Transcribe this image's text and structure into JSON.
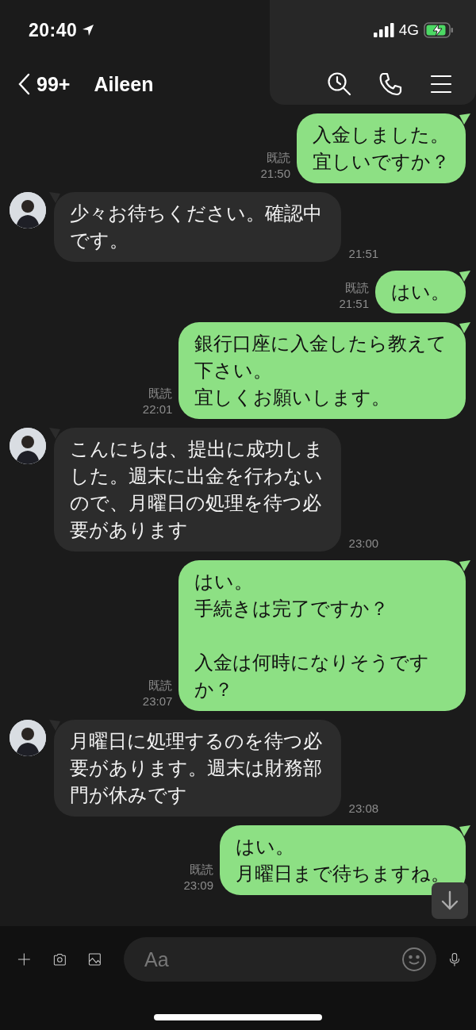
{
  "status_bar": {
    "time": "20:40",
    "network": "4G"
  },
  "header": {
    "back_count": "99+",
    "contact": "Aileen"
  },
  "messages": [
    {
      "kind": "sent",
      "paragraphs": [
        [
          "入金しました。",
          "宜しいですか？"
        ]
      ],
      "read": "既読",
      "time": "21:50"
    },
    {
      "kind": "received",
      "paragraphs": [
        [
          "少々お待ちください。確認中です。"
        ]
      ],
      "time": "21:51"
    },
    {
      "kind": "sent",
      "paragraphs": [
        [
          "はい。"
        ]
      ],
      "read": "既読",
      "time": "21:51"
    },
    {
      "kind": "sent",
      "paragraphs": [
        [
          "銀行口座に入金したら教えて下さい。",
          "宜しくお願いします。"
        ]
      ],
      "read": "既読",
      "time": "22:01"
    },
    {
      "kind": "received",
      "paragraphs": [
        [
          "こんにちは、提出に成功しました。週末に出金を行わないので、月曜日の処理を待つ必要があります"
        ]
      ],
      "time": "23:00"
    },
    {
      "kind": "sent",
      "paragraphs": [
        [
          "はい。",
          "手続きは完了ですか？"
        ],
        [
          "入金は何時になりそうですか？"
        ]
      ],
      "read": "既読",
      "time": "23:07"
    },
    {
      "kind": "received",
      "paragraphs": [
        [
          "月曜日に処理するのを待つ必要があります。週末は財務部門が休みです"
        ]
      ],
      "time": "23:08"
    },
    {
      "kind": "sent",
      "paragraphs": [
        [
          "はい。",
          "月曜日まで待ちますね。"
        ]
      ],
      "read": "既読",
      "time": "23:09"
    }
  ],
  "composer": {
    "placeholder": "Aa"
  }
}
